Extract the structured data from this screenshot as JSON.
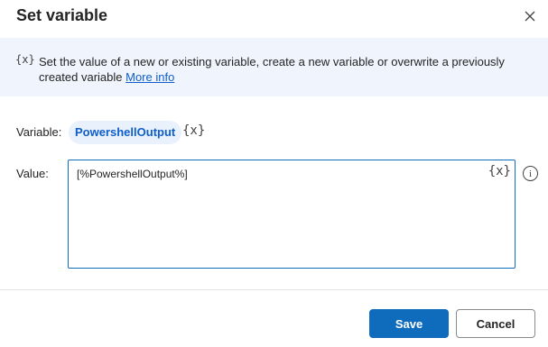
{
  "dialog": {
    "title": "Set variable",
    "close_icon": "close-icon"
  },
  "banner": {
    "icon_text": "{x}",
    "description": "Set the value of a new or existing variable, create a new variable or overwrite a previously created variable",
    "link_text": "More info"
  },
  "form": {
    "variable_label": "Variable:",
    "variable_name": "PowershellOutput",
    "variable_picker": "{x}",
    "value_label": "Value:",
    "value_text": "[%PowershellOutput%]",
    "value_picker": "{x}",
    "help_icon_text": "i"
  },
  "footer": {
    "save_label": "Save",
    "cancel_label": "Cancel"
  },
  "colors": {
    "accent": "#0f6cbd",
    "banner_bg": "#f0f5fd",
    "link": "#0f5ec9",
    "chip_bg": "#e8f1fc"
  }
}
